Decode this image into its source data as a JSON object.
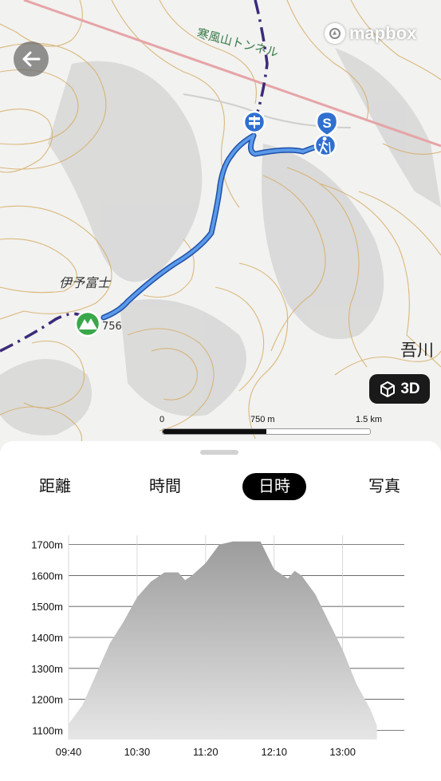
{
  "map": {
    "labels": {
      "tunnel": "寒風山トンネル",
      "peak": "伊予富士",
      "elevation": "756",
      "place": "吾川"
    },
    "start_marker": "S",
    "scale": {
      "zero": "0",
      "mid": "750 m",
      "max": "1.5 km"
    },
    "mapbox_label": "mapbox",
    "btn_3d_label": "3D",
    "icons": [
      "back-arrow-icon",
      "mapbox-logo-icon",
      "cube-icon",
      "signpost-icon",
      "hiker-icon",
      "mountain-icon"
    ],
    "colors": {
      "route": "#3c78d8",
      "marker": "#2f6fd0",
      "peak": "#3aa84a",
      "boundary": "#3c2a7a",
      "road": "#e8a3a6",
      "contour": "#d9b06a"
    }
  },
  "tabs": [
    {
      "label": "距離",
      "active": false
    },
    {
      "label": "時間",
      "active": false
    },
    {
      "label": "日時",
      "active": true
    },
    {
      "label": "写真",
      "active": false
    }
  ],
  "chart_data": {
    "type": "area",
    "yticks": [
      "1700m",
      "1600m",
      "1500m",
      "1400m",
      "1300m",
      "1200m",
      "1100m"
    ],
    "xticks": [
      "09:40",
      "10:30",
      "11:20",
      "12:10",
      "13:00"
    ],
    "ylim": [
      1070,
      1730
    ],
    "xlim_minutes": [
      580,
      825
    ],
    "series": [
      {
        "x": [
          "09:40",
          "09:50",
          "10:00",
          "10:10",
          "10:20",
          "10:30",
          "10:40",
          "10:50",
          "11:00",
          "11:05",
          "11:10",
          "11:20",
          "11:30",
          "11:40",
          "11:50",
          "12:00",
          "12:10",
          "12:20",
          "12:25",
          "12:30",
          "12:40",
          "12:50",
          "13:00",
          "13:10",
          "13:20",
          "13:25"
        ],
        "y": [
          1120,
          1180,
          1280,
          1380,
          1450,
          1530,
          1580,
          1610,
          1610,
          1585,
          1600,
          1640,
          1700,
          1710,
          1710,
          1710,
          1620,
          1590,
          1615,
          1600,
          1540,
          1450,
          1360,
          1250,
          1170,
          1115
        ]
      }
    ],
    "colors": {
      "fill_top": "#9c9c9c",
      "fill_bottom": "#e6e6e6",
      "grid": "#555555"
    }
  }
}
